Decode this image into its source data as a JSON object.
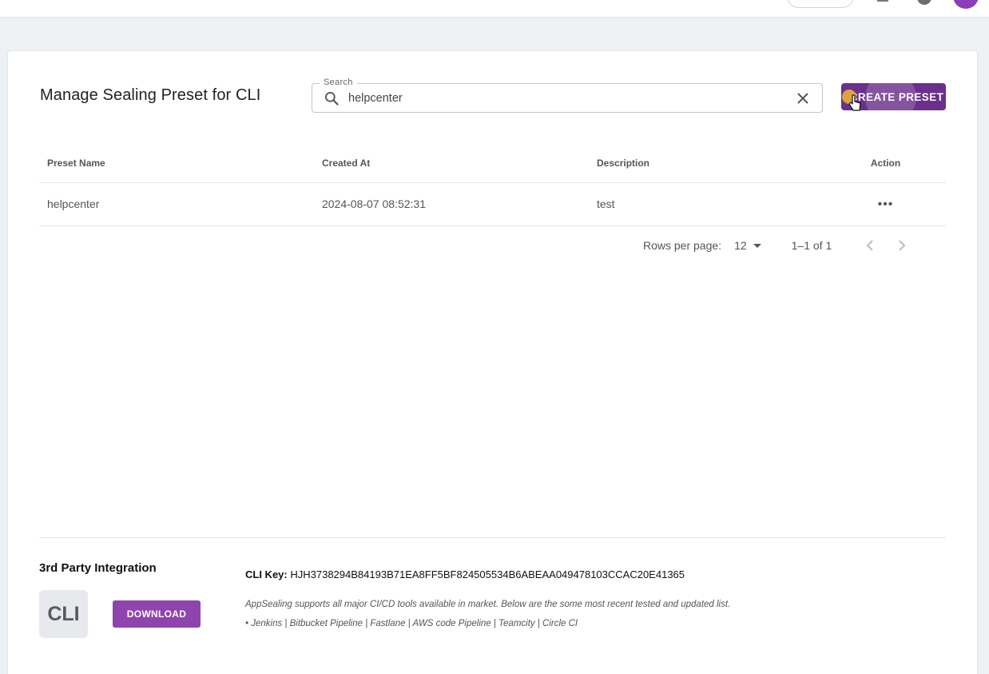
{
  "page": {
    "title": "Manage Sealing Preset for CLI"
  },
  "search": {
    "legend": "Search",
    "value": "helpcenter"
  },
  "actions": {
    "create_label": "CREATE PRESET"
  },
  "table": {
    "headers": [
      "Preset Name",
      "Created At",
      "Description",
      "Action"
    ],
    "rows": [
      {
        "name": "helpcenter",
        "created_at": "2024-08-07 08:52:31",
        "description": "test",
        "action": "•••"
      }
    ]
  },
  "pagination": {
    "rows_label": "Rows per page:",
    "rows_value": "12",
    "range": "1–1 of 1"
  },
  "integration": {
    "title": "3rd Party Integration",
    "badge": "CLI",
    "download_label": "DOWNLOAD",
    "cli_key_label": "CLI Key:",
    "cli_key_value": "HJH3738294B84193B71EA8FF5BF824505534B6ABEAA049478103CCAC20E41365",
    "description": "AppSealing supports all major CI/CD tools available in market. Below are the some most recent tested and updated list.",
    "tools": "• Jenkins | Bitbucket Pipeline | Fastlane | AWS code Pipeline | Teamcity | Circle CI"
  },
  "colors": {
    "primary": "#6b2f8c",
    "download": "#8e44ad",
    "background": "#eef1f4"
  },
  "icons": [
    "search-icon",
    "clear-icon",
    "more-icon",
    "chevron-left-icon",
    "chevron-right-icon",
    "bell-icon",
    "help-icon",
    "avatar"
  ]
}
